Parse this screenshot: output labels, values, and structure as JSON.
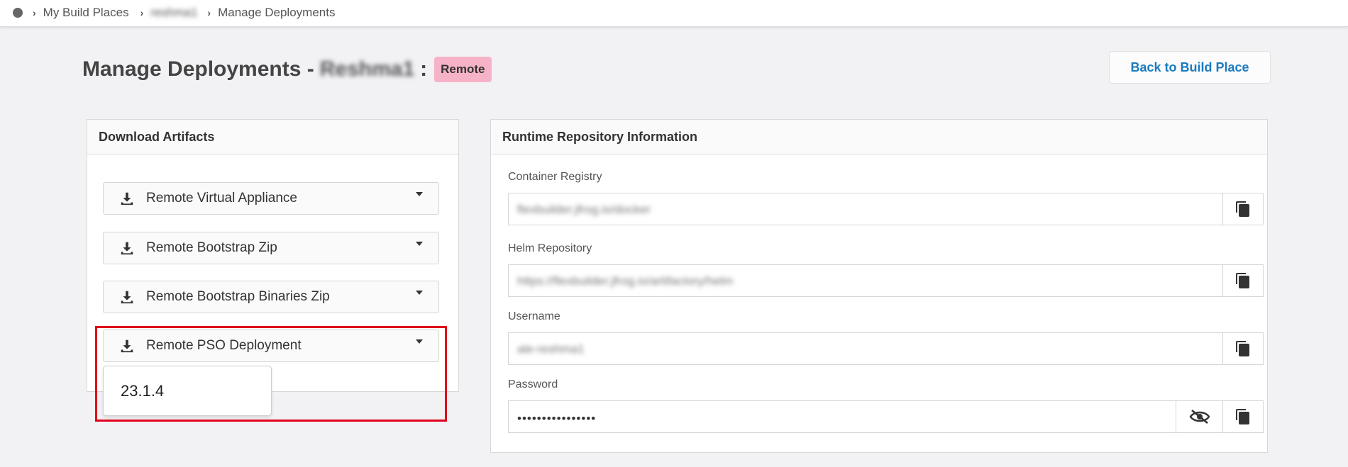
{
  "breadcrumb": {
    "items": [
      "My Build Places",
      "reshma1",
      "Manage Deployments"
    ]
  },
  "header": {
    "title_prefix": "Manage Deployments -",
    "build_place_name": "Reshma1",
    "separator": ":",
    "badge": "Remote",
    "back_button": "Back to Build Place"
  },
  "download": {
    "title": "Download Artifacts",
    "items": [
      {
        "label": "Remote Virtual Appliance"
      },
      {
        "label": "Remote Bootstrap Zip"
      },
      {
        "label": "Remote Bootstrap Binaries Zip"
      },
      {
        "label": "Remote PSO Deployment"
      }
    ],
    "dropdown_option": "23.1.4"
  },
  "runtime": {
    "title": "Runtime Repository Information",
    "container_registry": {
      "label": "Container Registry",
      "value": "flexbuilder.jfrog.io/docker"
    },
    "helm_repository": {
      "label": "Helm Repository",
      "value": "https://flexbuilder.jfrog.io/artifactory/helm"
    },
    "username": {
      "label": "Username",
      "value": "ale-reshma1"
    },
    "password": {
      "label": "Password",
      "value": "••••••••••••••••"
    }
  },
  "colors": {
    "accent_link": "#1a7bbf",
    "badge_bg": "#f6b3c8",
    "highlight": "#e0001a"
  }
}
